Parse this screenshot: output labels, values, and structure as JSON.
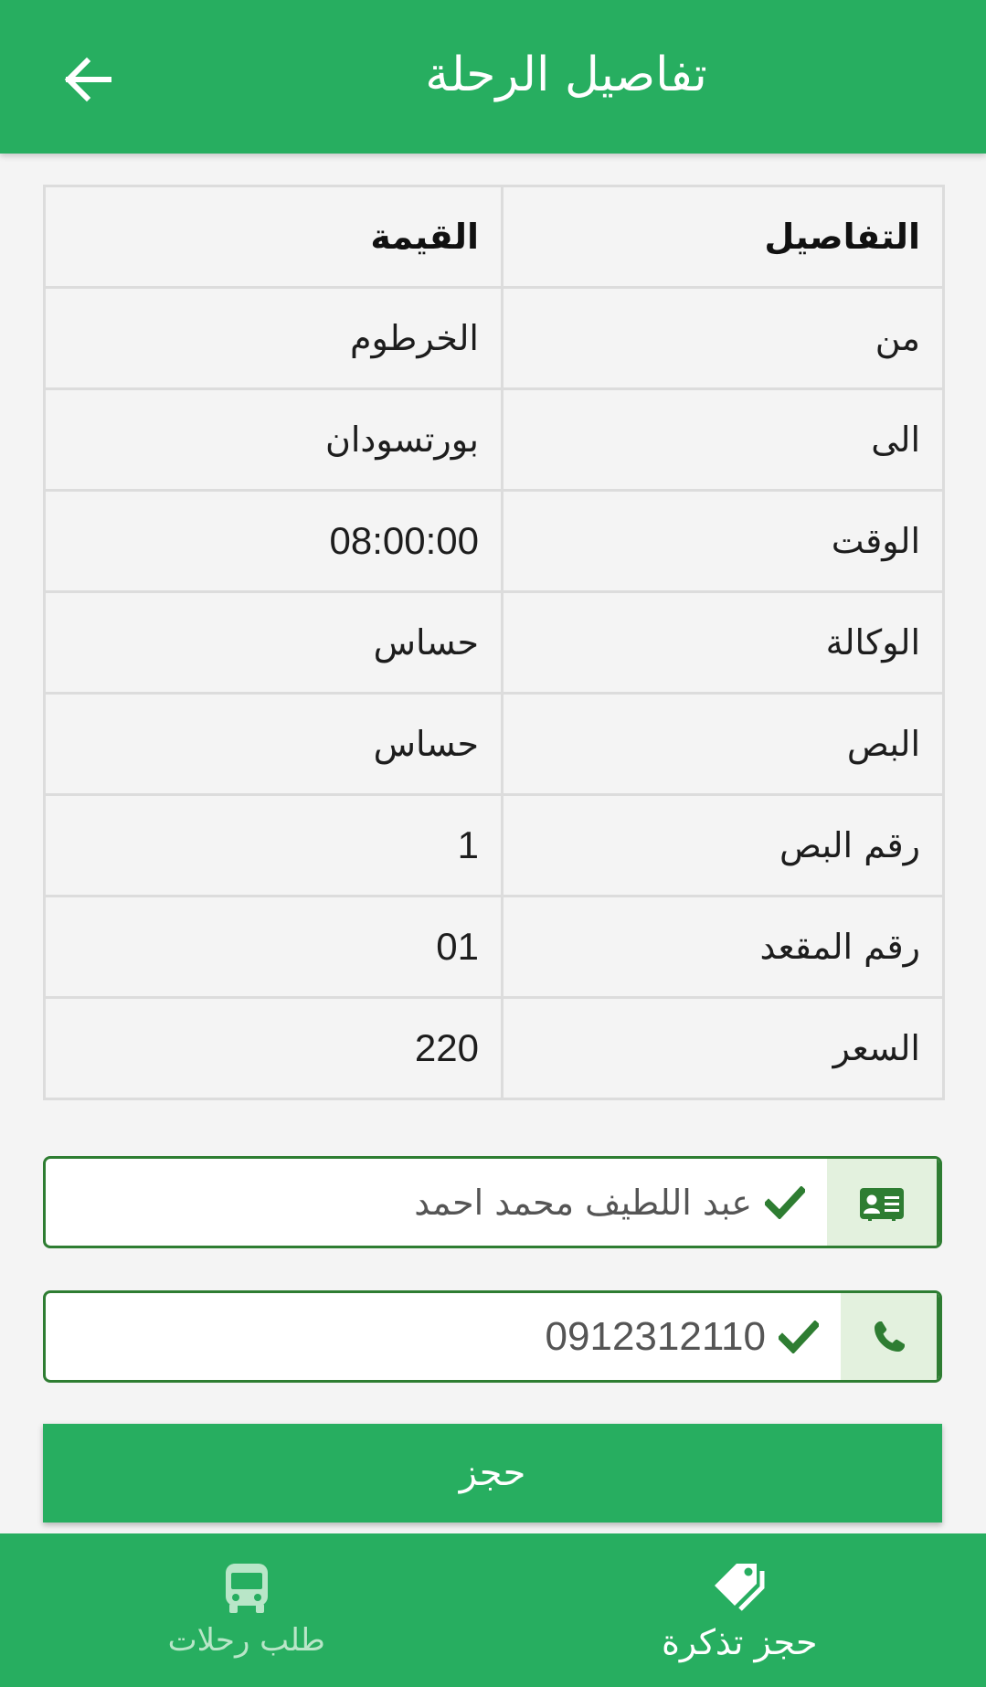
{
  "header": {
    "title": "تفاصيل الرحلة",
    "back_icon": "arrow-left-icon"
  },
  "table": {
    "headers": {
      "key": "التفاصيل",
      "value": "القيمة"
    },
    "rows": [
      {
        "key": "من",
        "value": "الخرطوم"
      },
      {
        "key": "الى",
        "value": "بورتسودان"
      },
      {
        "key": "الوقت",
        "value": "08:00:00"
      },
      {
        "key": "الوكالة",
        "value": "حساس"
      },
      {
        "key": "البص",
        "value": "حساس"
      },
      {
        "key": "رقم البص",
        "value": "1"
      },
      {
        "key": "رقم المقعد",
        "value": "01"
      },
      {
        "key": "السعر",
        "value": "220"
      }
    ]
  },
  "form": {
    "name": {
      "value": "عبد اللطيف محمد احمد",
      "icon": "id-card-icon"
    },
    "phone": {
      "value": "0912312110",
      "icon": "phone-icon"
    },
    "book_label": "حجز"
  },
  "bottom_nav": {
    "items": [
      {
        "label": "طلب رحلات",
        "icon": "bus-icon",
        "active": false
      },
      {
        "label": "حجز تذكرة",
        "icon": "tag-icon",
        "active": true
      }
    ]
  },
  "colors": {
    "primary": "#27ae60",
    "input_border": "#2e7d32",
    "addon_bg": "#e3f1de",
    "background": "#f4f4f4"
  }
}
